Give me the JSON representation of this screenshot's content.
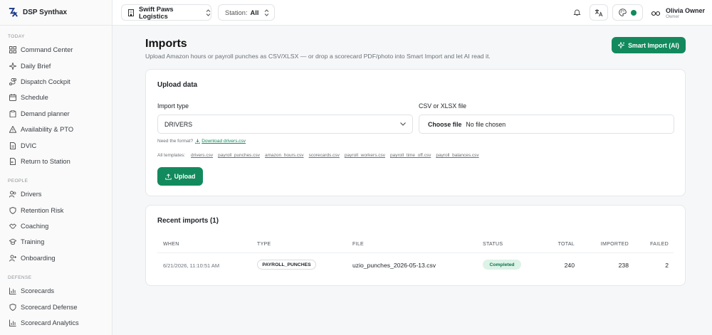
{
  "brand": {
    "name": "DSP Synthax"
  },
  "sidebar": {
    "sections": [
      {
        "label": "TODAY",
        "items": [
          {
            "label": "Command Center",
            "icon": "grid-icon"
          },
          {
            "label": "Daily Brief",
            "icon": "sparkle-icon"
          },
          {
            "label": "Dispatch Cockpit",
            "icon": "route-icon"
          },
          {
            "label": "Schedule",
            "icon": "calendar-icon"
          },
          {
            "label": "Demand planner",
            "icon": "clipboard-icon"
          },
          {
            "label": "Availability & PTO",
            "icon": "alert-triangle-icon"
          },
          {
            "label": "DVIC",
            "icon": "document-icon"
          },
          {
            "label": "Return to Station",
            "icon": "return-icon"
          }
        ]
      },
      {
        "label": "PEOPLE",
        "items": [
          {
            "label": "Drivers",
            "icon": "users-icon"
          },
          {
            "label": "Retention Risk",
            "icon": "shield-icon"
          },
          {
            "label": "Coaching",
            "icon": "handshake-icon"
          },
          {
            "label": "Training",
            "icon": "mortarboard-icon"
          },
          {
            "label": "Onboarding",
            "icon": "user-plus-icon"
          }
        ]
      },
      {
        "label": "DEFENSE",
        "items": [
          {
            "label": "Scorecards",
            "icon": "bar-chart-icon"
          },
          {
            "label": "Scorecard Defense",
            "icon": "shield-icon"
          },
          {
            "label": "Scorecard Analytics",
            "icon": "bar-chart-icon"
          }
        ]
      }
    ]
  },
  "topbar": {
    "company": "Swift Paws Logistics",
    "station_label": "Station:",
    "station_value": "All",
    "user_name": "Olivia Owner",
    "user_role": "Owner",
    "status_color": "#128a5d"
  },
  "page": {
    "title": "Imports",
    "subtitle": "Upload Amazon hours or payroll punches as CSV/XLSX — or drop a scorecard PDF/photo into Smart Import and let AI read it.",
    "smart_import_label": "Smart Import (AI)"
  },
  "upload": {
    "title": "Upload data",
    "import_type_label": "Import type",
    "import_type_value": "DRIVERS",
    "file_label": "CSV or XLSX file",
    "choose_file": "Choose file",
    "no_file": "No file chosen",
    "need_format": "Need the format?",
    "download_link": "Download drivers.csv",
    "templates_label": "All templates:",
    "templates": [
      "drivers.csv",
      "payroll_punches.csv",
      "amazon_hours.csv",
      "scorecards.csv",
      "payroll_workers.csv",
      "payroll_time_off.csv",
      "payroll_balances.csv"
    ],
    "upload_label": "Upload"
  },
  "recent": {
    "title": "Recent imports (1)",
    "columns": [
      "WHEN",
      "TYPE",
      "FILE",
      "STATUS",
      "TOTAL",
      "IMPORTED",
      "FAILED"
    ],
    "rows": [
      {
        "when": "6/21/2026, 11:10:51 AM",
        "type": "PAYROLL_PUNCHES",
        "file": "uzio_punches_2026-05-13.csv",
        "status": "Completed",
        "total": "240",
        "imported": "238",
        "failed": "2"
      }
    ]
  },
  "colors": {
    "accent": "#128a5d",
    "badge_bg": "#dcf3e7",
    "badge_text": "#12734d"
  }
}
